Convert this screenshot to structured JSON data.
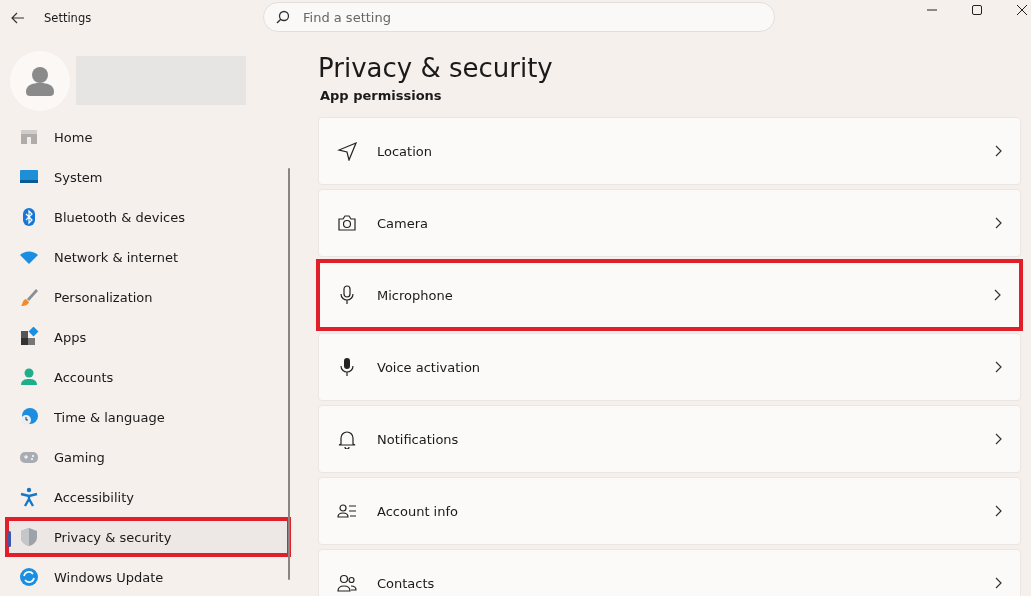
{
  "window": {
    "title": "Settings"
  },
  "search": {
    "placeholder": "Find a setting"
  },
  "sidebar": {
    "items": [
      {
        "label": "Home",
        "selected": false,
        "highlighted": false
      },
      {
        "label": "System",
        "selected": false,
        "highlighted": false
      },
      {
        "label": "Bluetooth & devices",
        "selected": false,
        "highlighted": false
      },
      {
        "label": "Network & internet",
        "selected": false,
        "highlighted": false
      },
      {
        "label": "Personalization",
        "selected": false,
        "highlighted": false
      },
      {
        "label": "Apps",
        "selected": false,
        "highlighted": false
      },
      {
        "label": "Accounts",
        "selected": false,
        "highlighted": false
      },
      {
        "label": "Time & language",
        "selected": false,
        "highlighted": false
      },
      {
        "label": "Gaming",
        "selected": false,
        "highlighted": false
      },
      {
        "label": "Accessibility",
        "selected": false,
        "highlighted": false
      },
      {
        "label": "Privacy & security",
        "selected": true,
        "highlighted": true
      },
      {
        "label": "Windows Update",
        "selected": false,
        "highlighted": false
      }
    ]
  },
  "page": {
    "title": "Privacy & security",
    "section": "App permissions",
    "items": [
      {
        "label": "Location",
        "highlighted": false
      },
      {
        "label": "Camera",
        "highlighted": false
      },
      {
        "label": "Microphone",
        "highlighted": true
      },
      {
        "label": "Voice activation",
        "highlighted": false
      },
      {
        "label": "Notifications",
        "highlighted": false
      },
      {
        "label": "Account info",
        "highlighted": false
      },
      {
        "label": "Contacts",
        "highlighted": false
      }
    ]
  }
}
